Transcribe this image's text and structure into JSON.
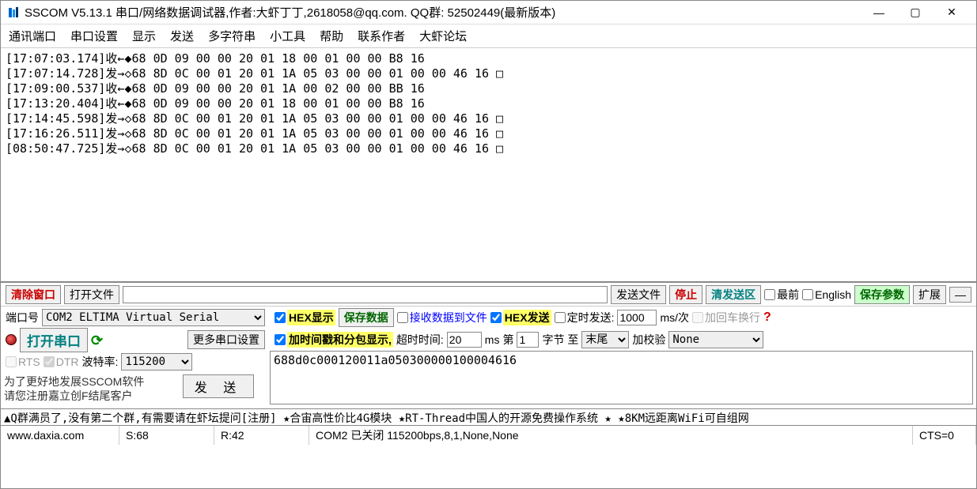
{
  "window": {
    "title": "SSCOM V5.13.1 串口/网络数据调试器,作者:大虾丁丁,2618058@qq.com. QQ群: 52502449(最新版本)"
  },
  "menu": {
    "items": [
      "通讯端口",
      "串口设置",
      "显示",
      "发送",
      "多字符串",
      "小工具",
      "帮助",
      "联系作者",
      "大虾论坛"
    ]
  },
  "log_lines": [
    "[17:07:03.174]收←◆68 0D 09 00 00 20 01 18 00 01 00 00 B8 16 ",
    "[17:07:14.728]发→◇68 8D 0C 00 01 20 01 1A 05 03 00 00 01 00 00 46 16 □",
    "[17:09:00.537]收←◆68 0D 09 00 00 20 01 1A 00 02 00 00 BB 16 ",
    "[17:13:20.404]收←◆68 0D 09 00 00 20 01 18 00 01 00 00 B8 16 ",
    "[17:14:45.598]发→◇68 8D 0C 00 01 20 01 1A 05 03 00 00 01 00 00 46 16 □",
    "[17:16:26.511]发→◇68 8D 0C 00 01 20 01 1A 05 03 00 00 01 00 00 46 16 □",
    "[08:50:47.725]发→◇68 8D 0C 00 01 20 01 1A 05 03 00 00 01 00 00 46 16 □"
  ],
  "ctrl1": {
    "clear": "清除窗口",
    "openfile": "打开文件",
    "sendfile": "发送文件",
    "stop": "停止",
    "clearsend": "清发送区",
    "topmost": "最前",
    "english": "English",
    "saveparam": "保存参数",
    "expand": "扩展",
    "minus": "—"
  },
  "port": {
    "label": "端口号",
    "value": "COM2 ELTIMA Virtual Serial",
    "hexdisp": "HEX显示",
    "savedata": "保存数据",
    "rxtofile": "接收数据到文件",
    "hexsend": "HEX发送",
    "timedsend": "定时发送:",
    "interval": "1000",
    "intervalunit": "ms/次",
    "addcrlf": "加回车换行"
  },
  "serial": {
    "open": "打开串口",
    "more": "更多串口设置",
    "timestamp": "加时间戳和分包显示,",
    "timeoutlabel": "超时时间:",
    "timeout": "20",
    "timeoutunit": "ms",
    "bytelabel1": "第",
    "byteval": "1",
    "bytelabel2": "字节 至",
    "tail": "末尾",
    "addcheck": "加校验",
    "checktype": "None",
    "rts": "RTS",
    "dtr": "DTR",
    "baudlabel": "波特率:",
    "baud": "115200"
  },
  "send": {
    "text": "688d0c000120011a050300000100004616",
    "button": "发 送"
  },
  "promo": {
    "line1": "为了更好地发展SSCOM软件",
    "line2": "请您注册嘉立创F结尾客户"
  },
  "ad": "▲Q群满员了,没有第二个群,有需要请在虾坛提问[注册] ★合宙高性价比4G模块 ★RT-Thread中国人的开源免费操作系统 ★ ★8KM远距离WiFi可自组网",
  "status": {
    "url": "www.daxia.com",
    "s": "S:68",
    "r": "R:42",
    "main": "COM2 已关闭 115200bps,8,1,None,None",
    "cts": "CTS=0"
  }
}
